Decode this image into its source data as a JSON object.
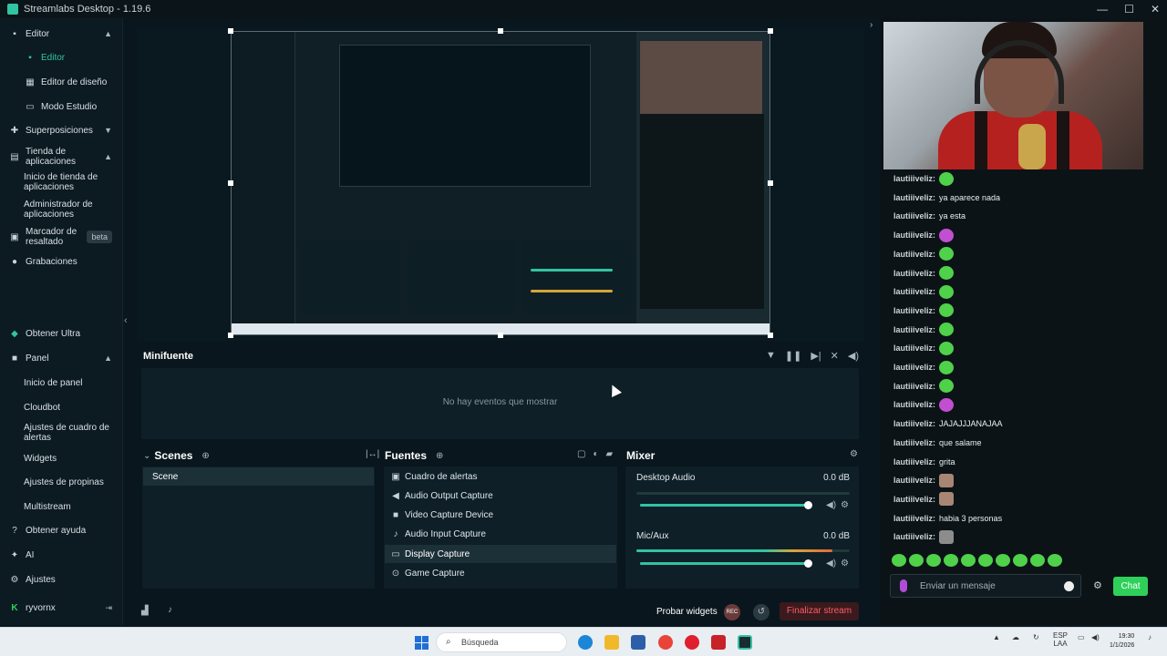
{
  "window": {
    "title": "Streamlabs Desktop - 1.19.6"
  },
  "sidebar": {
    "editor": "Editor",
    "editor_sub": [
      "Editor",
      "Editor de diseño",
      "Modo Estudio"
    ],
    "overlays": "Superposiciones",
    "app_store": "Tienda de aplicaciones",
    "app_store_sub": [
      "Inicio de tienda de aplicaciones",
      "Administrador de aplicaciones"
    ],
    "highlighter": "Marcador de resaltado",
    "highlighter_badge": "beta",
    "recordings": "Grabaciones",
    "get_ultra": "Obtener Ultra",
    "dashboard": "Panel",
    "dashboard_sub": [
      "Inicio de panel",
      "Cloudbot",
      "Ajustes de cuadro de alertas",
      "Widgets",
      "Ajustes de propinas",
      "Multistream"
    ],
    "help": "Obtener ayuda",
    "ai": "AI",
    "settings": "Ajustes",
    "user": "ryvornx"
  },
  "minifeed": {
    "title": "Minifuente",
    "empty": "No hay eventos que mostrar"
  },
  "scenes": {
    "title": "Scenes",
    "items": [
      "Scene"
    ]
  },
  "sources": {
    "title": "Fuentes",
    "items": [
      {
        "label": "Cuadro de alertas",
        "icon": "alert-box-icon"
      },
      {
        "label": "Audio Output Capture",
        "icon": "speaker-icon"
      },
      {
        "label": "Video Capture Device",
        "icon": "camera-icon"
      },
      {
        "label": "Audio Input Capture",
        "icon": "mic-icon"
      },
      {
        "label": "Display Capture",
        "icon": "monitor-icon"
      },
      {
        "label": "Game Capture",
        "icon": "gamepad-icon"
      }
    ],
    "selected": "Display Capture"
  },
  "mixer": {
    "title": "Mixer",
    "channels": [
      {
        "name": "Desktop Audio",
        "db": "0.0 dB",
        "level": 0.0,
        "volume": 1.0
      },
      {
        "name": "Mic/Aux",
        "db": "0.0 dB",
        "level": 0.92,
        "volume": 1.0
      }
    ]
  },
  "footer": {
    "test_widgets": "Probar widgets",
    "rec_label": "REC",
    "go_live": "Finalizar stream"
  },
  "chat": {
    "messages": [
      {
        "user": "lautiiiveliz:",
        "text": "",
        "emote": "green"
      },
      {
        "user": "lautiiiveliz:",
        "text": "ya aparece nada"
      },
      {
        "user": "lautiiiveliz:",
        "text": "ya esta"
      },
      {
        "user": "lautiiiveliz:",
        "text": "",
        "emote": "purple"
      },
      {
        "user": "lautiiiveliz:",
        "text": "",
        "emote": "green"
      },
      {
        "user": "lautiiiveliz:",
        "text": "",
        "emote": "green"
      },
      {
        "user": "lautiiiveliz:",
        "text": "",
        "emote": "green"
      },
      {
        "user": "lautiiiveliz:",
        "text": "",
        "emote": "green"
      },
      {
        "user": "lautiiiveliz:",
        "text": "",
        "emote": "green"
      },
      {
        "user": "lautiiiveliz:",
        "text": "",
        "emote": "green"
      },
      {
        "user": "lautiiiveliz:",
        "text": "",
        "emote": "green"
      },
      {
        "user": "lautiiiveliz:",
        "text": "",
        "emote": "green"
      },
      {
        "user": "lautiiiveliz:",
        "text": "",
        "emote": "purple"
      },
      {
        "user": "lautiiiveliz:",
        "text": "JAJAJJJANAJAA"
      },
      {
        "user": "lautiiiveliz:",
        "text": "que salame"
      },
      {
        "user": "lautiiiveliz:",
        "text": "grita"
      },
      {
        "user": "lautiiiveliz:",
        "text": "",
        "emote": "photo"
      },
      {
        "user": "lautiiiveliz:",
        "text": "",
        "emote": "photo"
      },
      {
        "user": "lautiiiveliz:",
        "text": "habia 3 personas"
      },
      {
        "user": "lautiiiveliz:",
        "text": "",
        "emote": "grey"
      }
    ],
    "input_placeholder": "Enviar un mensaje",
    "send_label": "Chat"
  },
  "taskbar": {
    "search_placeholder": "Búsqueda",
    "lang": "ESP",
    "lang2": "LAA",
    "time": "19:30",
    "date": "1/1/2026"
  },
  "colors": {
    "accent": "#31c3a2",
    "chat_green": "#2fd05a",
    "live_red": "#ff5c67"
  }
}
